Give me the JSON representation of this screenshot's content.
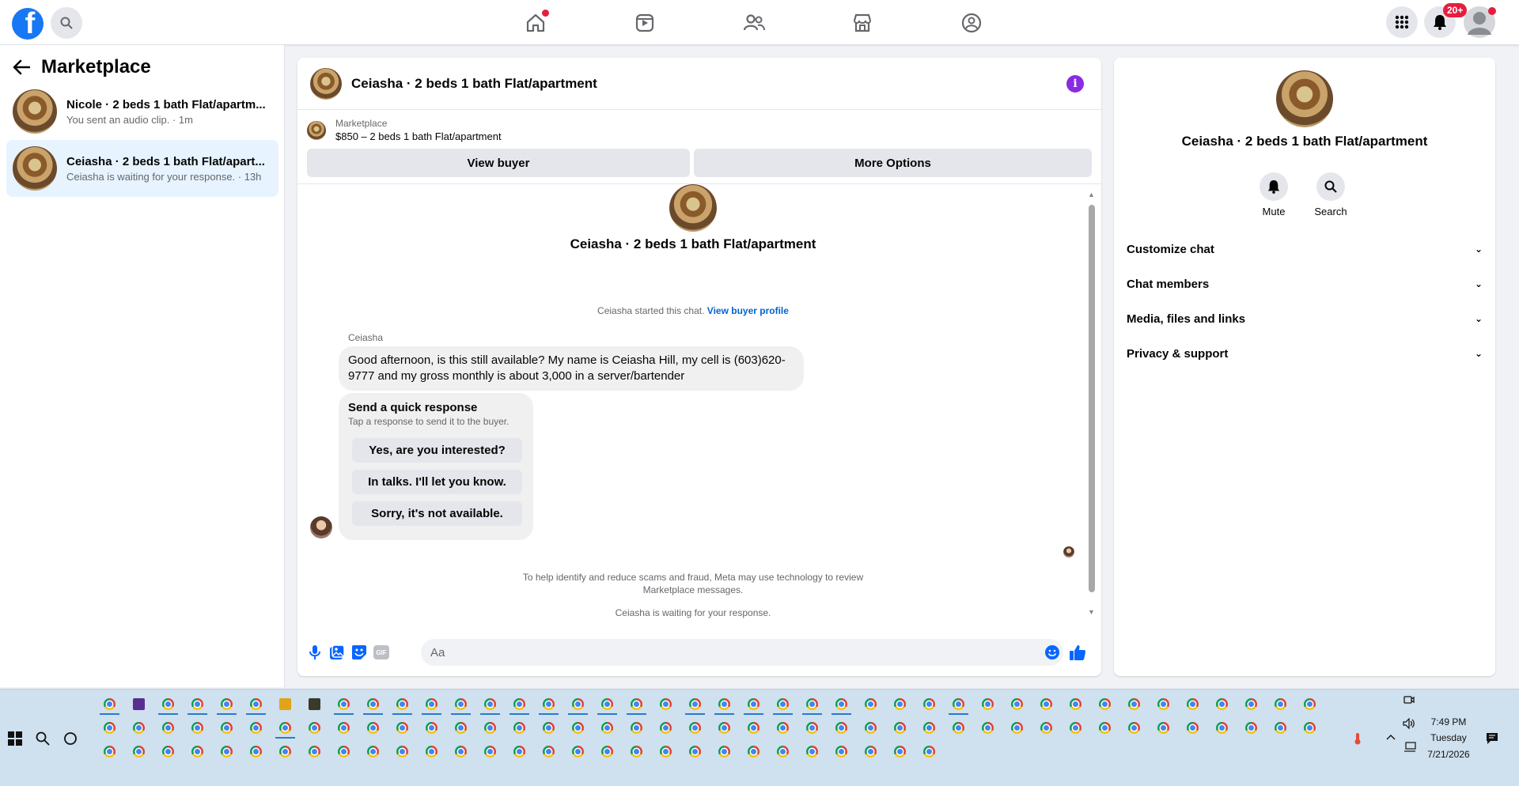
{
  "colors": {
    "brand": "#1877f2",
    "info": "#8a2be2",
    "notification": "#e41e3f",
    "link": "#0064d1"
  },
  "topbar": {
    "nav_icons": [
      "home-icon",
      "watch-icon",
      "friends-icon",
      "marketplace-icon",
      "groups-icon"
    ],
    "notification_count": "20+"
  },
  "sidebar": {
    "title": "Marketplace",
    "conversations": [
      {
        "name": "Nicole · 2 beds 1 bath Flat/apartm...",
        "sub": "You sent an audio clip. · 1m"
      },
      {
        "name": "Ceiasha · 2 beds 1 bath Flat/apart...",
        "sub": "Ceiasha is waiting for your response. · 13h"
      }
    ]
  },
  "chat": {
    "title": "Ceiasha · 2 beds 1 bath Flat/apartment",
    "listing_label": "Marketplace",
    "listing_title": "$850 – 2 beds 1 bath Flat/apartment",
    "view_buyer": "View buyer",
    "more_options": "More Options",
    "center_name": "Ceiasha · 2 beds 1 bath Flat/apartment",
    "started_text": "Ceiasha started this chat.",
    "view_buyer_profile": "View buyer profile",
    "sender": "Ceiasha",
    "message_line1": "Good afternoon, is this still available? My name is Ceiasha Hill, my cell is (603)620-",
    "message_line2": "9777 and my gross monthly is about 3,000 in a server/bartender",
    "quick_title": "Send a quick response",
    "quick_sub": "Tap a response to send it to the buyer.",
    "quick_replies": [
      "Yes, are you interested?",
      "In talks. I'll let you know.",
      "Sorry, it's not available."
    ],
    "scam_notice_1": "To help identify and reduce scams and fraud, Meta may use technology to review",
    "scam_notice_2": "Marketplace messages.",
    "waiting": "Ceiasha is waiting for your response.",
    "input_placeholder": "Aa",
    "composer_icons": [
      "microphone-icon",
      "photo-icon",
      "sticker-icon",
      "gif-icon",
      "emoji-icon",
      "like-icon"
    ],
    "gif_label": "GIF"
  },
  "details": {
    "name": "Ceiasha · 2 beds 1 bath Flat/apartment",
    "mute": "Mute",
    "search": "Search",
    "sections": [
      "Customize chat",
      "Chat members",
      "Media, files and links",
      "Privacy & support"
    ]
  },
  "taskbar": {
    "time": "7:49 PM",
    "day": "Tuesday",
    "date": "7/21/2026"
  }
}
